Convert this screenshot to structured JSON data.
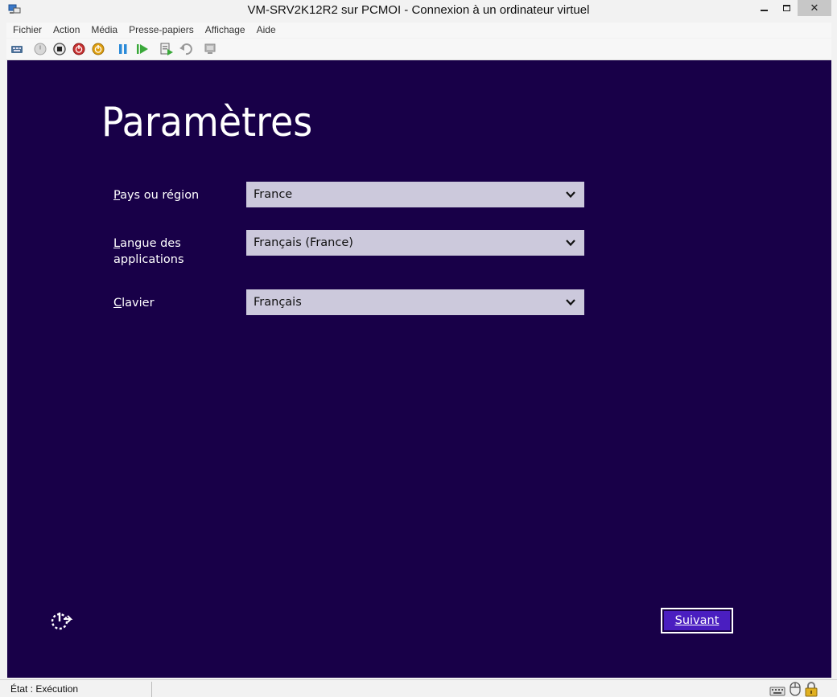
{
  "window": {
    "title": "VM-SRV2K12R2 sur PCMOI - Connexion à un ordinateur virtuel",
    "close_glyph": "✕"
  },
  "menubar": {
    "items": [
      "Fichier",
      "Action",
      "Média",
      "Presse-papiers",
      "Affichage",
      "Aide"
    ]
  },
  "toolbar": {
    "icons": [
      "ctrl-alt-del-icon",
      "start-icon",
      "turn-off-icon",
      "shutdown-icon",
      "power-icon",
      "pause-icon",
      "resume-icon",
      "checkpoint-icon",
      "revert-icon",
      "enhanced-session-icon"
    ]
  },
  "setup": {
    "title": "Paramètres",
    "fields": [
      {
        "label_first": "P",
        "label_rest": "ays ou région",
        "value": "France"
      },
      {
        "label_first": "L",
        "label_rest": "angue des",
        "label_line2": "applications",
        "value": "Français (France)"
      },
      {
        "label_first": "C",
        "label_rest": "lavier",
        "value": "Français"
      }
    ],
    "next_first": "S",
    "next_rest": "uivant"
  },
  "statusbar": {
    "state": "État : Exécution"
  },
  "colors": {
    "screen_bg": "#180048",
    "select_bg": "#ccc9dc",
    "button_fill": "#4a1ec0"
  }
}
